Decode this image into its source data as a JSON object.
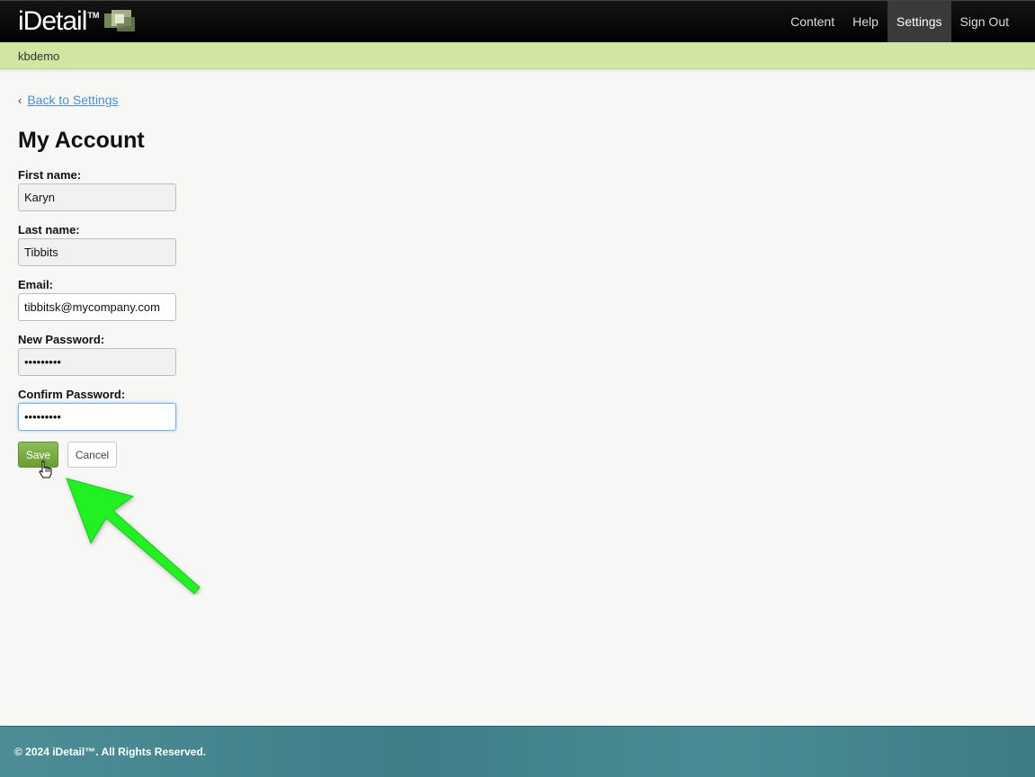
{
  "header": {
    "logo_text": "iDetail",
    "logo_tm": "TM",
    "nav": [
      "Content",
      "Help",
      "Settings",
      "Sign Out"
    ],
    "active_nav": "Settings"
  },
  "subbar": {
    "org": "kbdemo"
  },
  "back_link": {
    "label": "Back to Settings"
  },
  "page_title": "My Account",
  "form": {
    "first_name": {
      "label": "First name:",
      "value": "Karyn"
    },
    "last_name": {
      "label": "Last name:",
      "value": "Tibbits"
    },
    "email": {
      "label": "Email:",
      "value": "tibbitsk@mycompany.com"
    },
    "new_password": {
      "label": "New Password:",
      "value": "•••••••••"
    },
    "confirm_password": {
      "label": "Confirm Password:",
      "value": "•••••••••"
    },
    "save_label": "Save",
    "cancel_label": "Cancel"
  },
  "footer": {
    "copyright": "© 2024 iDetail™.  All Rights Reserved."
  },
  "colors": {
    "subbar": "#d3e5a2",
    "save_button": "#7aab46",
    "link": "#4d8fc7",
    "annotation_arrow": "#22f022",
    "footer": "#447f89"
  }
}
